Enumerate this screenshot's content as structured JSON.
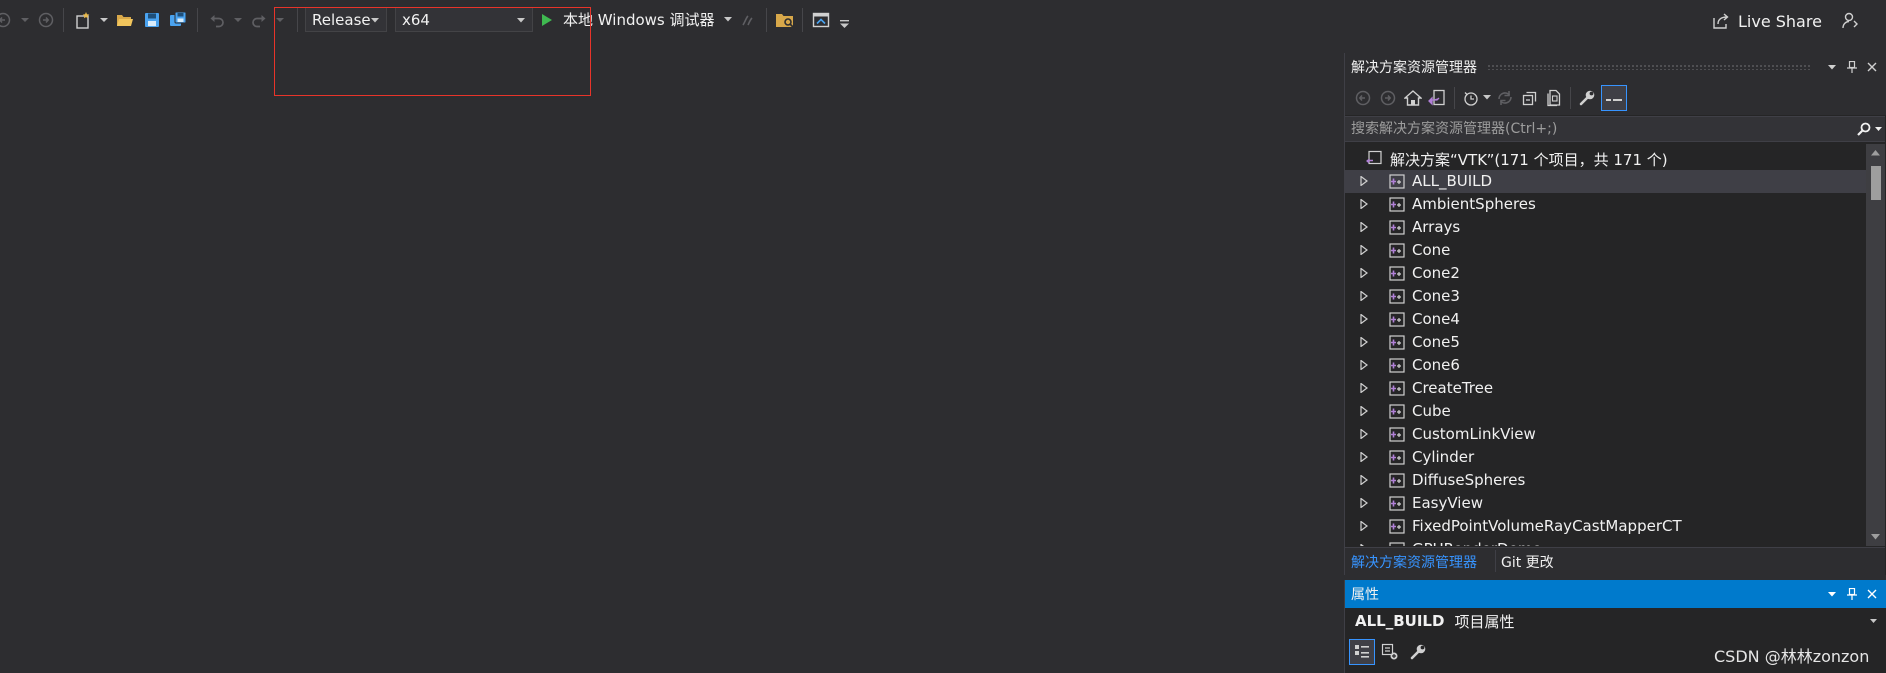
{
  "toolbar": {
    "configuration": "Release",
    "platform": "x64",
    "debug_target": "本地 Windows 调试器",
    "live_share": "Live Share"
  },
  "solution_explorer": {
    "title": "解决方案资源管理器",
    "search_placeholder": "搜索解决方案资源管理器(Ctrl+;)",
    "solution_label": "解决方案“VTK”(171 个项目，共 171 个)",
    "projects": [
      "ALL_BUILD",
      "AmbientSpheres",
      "Arrays",
      "Cone",
      "Cone2",
      "Cone3",
      "Cone4",
      "Cone5",
      "Cone6",
      "CreateTree",
      "Cube",
      "CustomLinkView",
      "Cylinder",
      "DiffuseSpheres",
      "EasyView",
      "FixedPointVolumeRayCastMapperCT",
      "GPURenderDemo"
    ],
    "selected_project": "ALL_BUILD",
    "tabs": [
      "解决方案资源管理器",
      "Git 更改"
    ]
  },
  "properties": {
    "title": "属性",
    "object_name": "ALL_BUILD",
    "object_kind": "项目属性"
  },
  "watermark": "CSDN @林林zonzon",
  "colors": {
    "background": "#2d2d30",
    "panel": "#252526",
    "accent": "#007acc",
    "highlight_box": "#e8342a",
    "play_green": "#3fb950"
  }
}
